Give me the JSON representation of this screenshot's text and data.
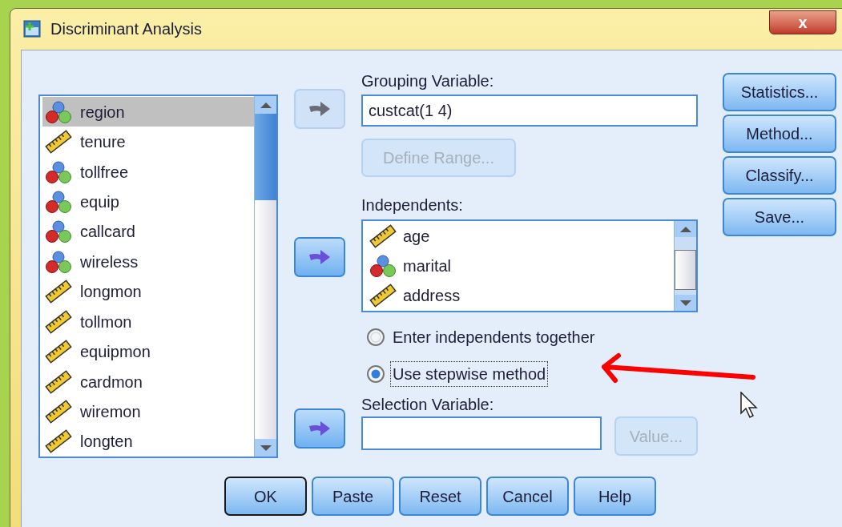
{
  "window": {
    "title": "Discriminant Analysis",
    "close_label": "x"
  },
  "variables": [
    {
      "name": "region",
      "kind": "nominal",
      "selected": true
    },
    {
      "name": "tenure",
      "kind": "scale",
      "selected": false
    },
    {
      "name": "tollfree",
      "kind": "nominal",
      "selected": false
    },
    {
      "name": "equip",
      "kind": "nominal",
      "selected": false
    },
    {
      "name": "callcard",
      "kind": "nominal",
      "selected": false
    },
    {
      "name": "wireless",
      "kind": "nominal",
      "selected": false
    },
    {
      "name": "longmon",
      "kind": "scale",
      "selected": false
    },
    {
      "name": "tollmon",
      "kind": "scale",
      "selected": false
    },
    {
      "name": "equipmon",
      "kind": "scale",
      "selected": false
    },
    {
      "name": "cardmon",
      "kind": "scale",
      "selected": false
    },
    {
      "name": "wiremon",
      "kind": "scale",
      "selected": false
    },
    {
      "name": "longten",
      "kind": "scale",
      "selected": false
    }
  ],
  "grouping": {
    "label": "Grouping Variable:",
    "value": "custcat(1 4)",
    "arrow_disabled": true
  },
  "define_range": {
    "label": "Define Range...",
    "disabled": true
  },
  "independents": {
    "label": "Independents:",
    "arrow_disabled": false,
    "items": [
      {
        "name": "age",
        "kind": "scale"
      },
      {
        "name": "marital",
        "kind": "nominal"
      },
      {
        "name": "address",
        "kind": "scale"
      }
    ]
  },
  "method_options": [
    {
      "label": "Enter independents together",
      "selected": false,
      "focused": false
    },
    {
      "label": "Use stepwise method",
      "selected": true,
      "focused": true
    }
  ],
  "selection": {
    "label": "Selection Variable:",
    "arrow_disabled": false
  },
  "value_button": {
    "label": "Value...",
    "disabled": true
  },
  "side_buttons": [
    "Statistics...",
    "Method...",
    "Classify...",
    "Save..."
  ],
  "buttons": [
    {
      "label": "OK",
      "default": true
    },
    {
      "label": "Paste",
      "default": false
    },
    {
      "label": "Reset",
      "default": false
    },
    {
      "label": "Cancel",
      "default": false
    },
    {
      "label": "Help",
      "default": false
    }
  ]
}
